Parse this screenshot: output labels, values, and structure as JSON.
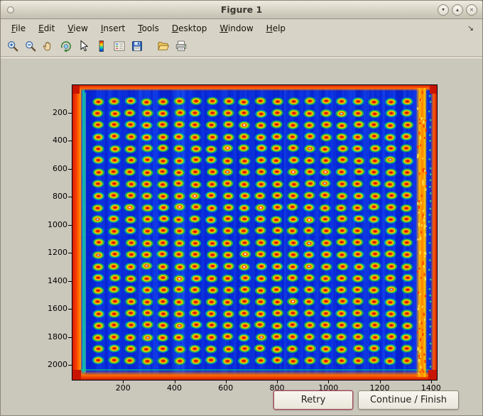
{
  "colors": {
    "chrome_bg": "#d7d3c6",
    "figure_bg": "#cac7bb",
    "titlebar_gradient_top": "#edebe0",
    "titlebar_gradient_bottom": "#c5c1b1",
    "retry_highlight_border": "#a04f5f"
  },
  "window": {
    "title": "Figure 1",
    "controls": [
      {
        "name": "minimize",
        "glyph": "▾"
      },
      {
        "name": "maximize",
        "glyph": "▴"
      },
      {
        "name": "close",
        "glyph": "×"
      }
    ]
  },
  "menu": {
    "items": [
      "File",
      "Edit",
      "View",
      "Insert",
      "Tools",
      "Desktop",
      "Window",
      "Help"
    ],
    "overflow_glyph": "↘"
  },
  "toolbar": {
    "groups": [
      [
        "zoom-in",
        "zoom-out",
        "pan",
        "rotate-3d",
        "data-cursor",
        "insert-colorbar",
        "insert-legend",
        "save"
      ],
      [
        "open",
        "print"
      ]
    ]
  },
  "chart_data": {
    "type": "heatmap",
    "title": "",
    "xlabel": "",
    "ylabel": "",
    "x_ticks": [
      200,
      400,
      600,
      800,
      1000,
      1200,
      1400
    ],
    "y_ticks": [
      200,
      400,
      600,
      800,
      1000,
      1200,
      1400,
      1600,
      1800,
      2000
    ],
    "xlim": [
      0,
      1420
    ],
    "ylim": [
      0,
      2100
    ],
    "y_axis_direction": "reversed",
    "grid": false,
    "legend": false,
    "content": {
      "description": "False-color (jet colormap) image of a well plate: roughly 20 x 23 grid of hot spots (red cores with yellow and green halos) on a deep blue background, hot red-orange plate edges, a bright orange vertical band near the right edge and a cyan-green streak along the inner left edge",
      "grid_cols": 20,
      "grid_rows": 23,
      "background_color": "#0722cc",
      "well_core_color": "#f03000",
      "well_ring_color": "#ffd000",
      "well_halo_color": "#1ec84b",
      "edge_color": "#e02600",
      "right_band_color": "#ffb300"
    }
  },
  "buttons": {
    "retry": "Retry",
    "continue_finish": "Continue / Finish"
  }
}
